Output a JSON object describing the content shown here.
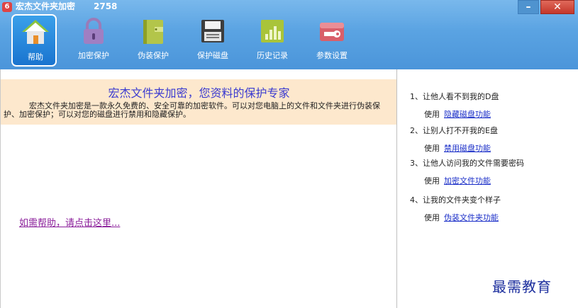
{
  "window": {
    "title": "宏杰文件夹加密",
    "version": "2758",
    "min_glyph": "–",
    "close_glyph": "✕"
  },
  "toolbar": {
    "items": [
      {
        "label": "帮助",
        "icon": "home-icon"
      },
      {
        "label": "加密保护",
        "icon": "lock-icon"
      },
      {
        "label": "伪装保护",
        "icon": "disguise-folder-icon"
      },
      {
        "label": "保护磁盘",
        "icon": "floppy-disk-icon"
      },
      {
        "label": "历史记录",
        "icon": "history-chart-icon"
      },
      {
        "label": "参数设置",
        "icon": "wrench-icon"
      }
    ]
  },
  "intro": {
    "title": "宏杰文件夹加密，您资料的保护专家",
    "body": "宏杰文件夹加密是一款永久免费的、安全可靠的加密软件。可以对您电脑上的文件和文件夹进行伪装保护、加密保护；可以对您的磁盘进行禁用和隐藏保护。"
  },
  "help_link": "如需帮助，请点击这里...",
  "tips": [
    {
      "q": "1、让他人看不到我的D盘",
      "use": "使用",
      "link": "隐藏磁盘功能"
    },
    {
      "q": "2、让别人打不开我的E盘",
      "use": "使用",
      "link": "禁用磁盘功能"
    },
    {
      "q": "3、让他人访问我的文件需要密码",
      "use": "使用",
      "link": "加密文件功能"
    },
    {
      "q": "4、让我的文件夹变个样子",
      "use": "使用",
      "link": "伪装文件夹功能"
    }
  ],
  "watermark": "最需教育",
  "colors": {
    "accent": "#4b95da",
    "intro_bg": "#fde8cd",
    "link": "#1a2ec8",
    "help_link": "#8a1d9a"
  }
}
